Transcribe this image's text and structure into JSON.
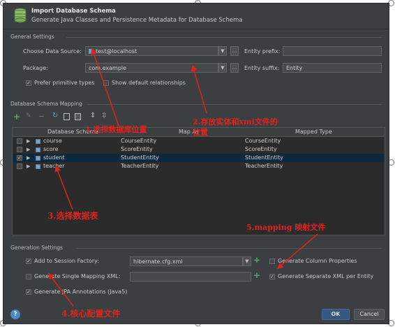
{
  "dialog": {
    "title": "Import Database Schema",
    "subtitle": "Generate Java Classes and Persistence Metadata for Database Schema"
  },
  "general": {
    "section_label": "General Settings",
    "data_source_label": "Choose Data Source:",
    "data_source_value": "test@localhost",
    "entity_prefix_label": "Entity prefix:",
    "entity_prefix_value": "",
    "package_label": "Package:",
    "package_value": "com.example",
    "entity_suffix_label": "Entity suffix:",
    "entity_suffix_value": "Entity",
    "prefer_primitive_label": "Prefer primitive types",
    "prefer_primitive_checked": true,
    "show_default_label": "Show default relationships",
    "show_default_checked": false
  },
  "mapping": {
    "section_label": "Database Schema Mapping",
    "toolbar_icons": [
      "add-icon",
      "edit-icon",
      "remove-icon",
      "refresh-icon",
      "copy-icon",
      "paste-icon",
      "expand-icon",
      "collapse-icon"
    ],
    "columns": [
      "Database Schema",
      "Map As",
      "Mapped Type"
    ],
    "rows": [
      {
        "name": "course",
        "map_as": "CourseEntity",
        "mapped_type": "CourseEntity",
        "checked": false,
        "selected": false
      },
      {
        "name": "score",
        "map_as": "ScoreEntity",
        "mapped_type": "ScoreEntity",
        "checked": false,
        "selected": false
      },
      {
        "name": "student",
        "map_as": "StudentEntity",
        "mapped_type": "StudentEntity",
        "checked": true,
        "selected": true
      },
      {
        "name": "teacher",
        "map_as": "TeacherEntity",
        "mapped_type": "TeacherEntity",
        "checked": false,
        "selected": false
      }
    ]
  },
  "generation": {
    "section_label": "Generation Settings",
    "add_session_factory_label": "Add to Session Factory:",
    "add_session_factory_checked": true,
    "session_factory_value": "hibernate.cfg.xml",
    "generate_single_label": "Generate Single Mapping XML:",
    "generate_single_checked": false,
    "generate_jpa_label": "Generate JPA Annotations (Java5)",
    "generate_jpa_checked": true,
    "generate_column_label": "Generate Column Properties",
    "generate_column_checked": false,
    "generate_separate_label": "Generate Separate XML per Entity",
    "generate_separate_checked": true
  },
  "buttons": {
    "help": "?",
    "ok": "OK",
    "cancel": "Cancel"
  },
  "annotations": {
    "a1": "1.选择数据库位置",
    "a2_line1": "2.存放实体和xml文件的",
    "a2_line2": "位置",
    "a3": "3.选择数据表",
    "a4": "4.核心配置文件",
    "a5": "5.mapping 映射文件"
  },
  "colors": {
    "dialog_bg": "#3c3f41",
    "table_bg": "#2b2b2b",
    "selection": "#0d293e",
    "annotation_red": "#e0231c",
    "add_green": "#59a869"
  }
}
